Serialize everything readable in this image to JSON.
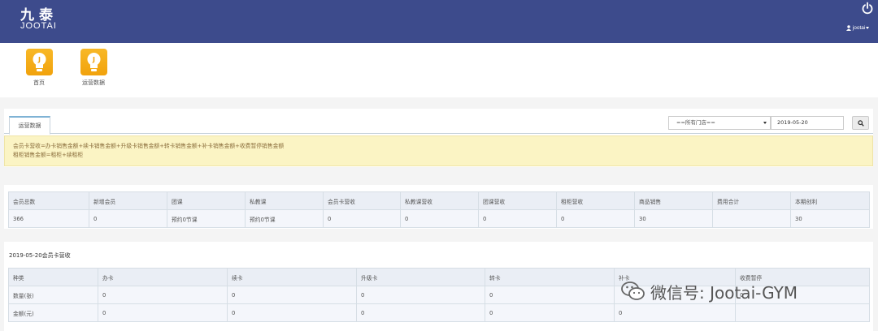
{
  "header": {
    "logo_cn": "九泰",
    "logo_en": "JOOTAI",
    "user_name": "jootai"
  },
  "apps": [
    {
      "label": "首页"
    },
    {
      "label": "运营数据"
    }
  ],
  "tab": {
    "label": "运营数据"
  },
  "filters": {
    "store_select": "==所有门店==",
    "date_value": "2019-05-20"
  },
  "notice": {
    "line1": "会员卡营收=办卡销售金额+续卡销售金额+升级卡销售金额+转卡销售金额+补卡销售金额+收费暂停销售金额",
    "line2": "租柜销售金额=租柜+续租柜"
  },
  "summary_table": {
    "headers": [
      "会员总数",
      "新增会员",
      "团课",
      "私教课",
      "会员卡营收",
      "私教课营收",
      "团课营收",
      "租柜营收",
      "商品销售",
      "费用合计",
      "本期创利"
    ],
    "values": [
      "366",
      "0",
      "预约0节课",
      "预约0节课",
      "0",
      "0",
      "0",
      "0",
      "30",
      "",
      "30"
    ]
  },
  "card_revenue": {
    "title": "2019-05-20会员卡营收",
    "headers": [
      "种类",
      "办卡",
      "续卡",
      "升级卡",
      "转卡",
      "补卡",
      "收费暂停"
    ],
    "rows": [
      {
        "label": "数量(张)",
        "values": [
          "0",
          "0",
          "0",
          "0",
          "",
          "0"
        ]
      },
      {
        "label": "金额(元)",
        "values": [
          "0",
          "0",
          "0",
          "0",
          "0",
          ""
        ]
      }
    ]
  },
  "watermark": {
    "text": "微信号: Jootai-GYM"
  }
}
